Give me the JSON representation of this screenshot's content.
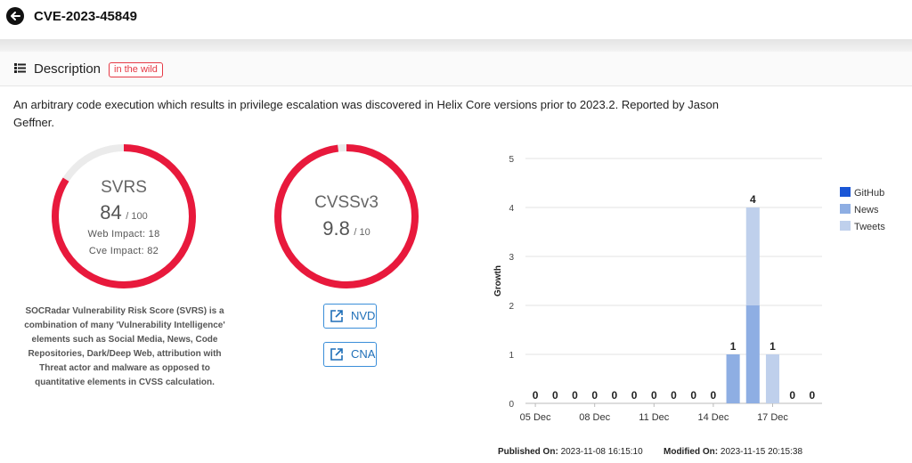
{
  "header": {
    "title": "CVE-2023-45849",
    "back_icon": "arrow-left-icon"
  },
  "description": {
    "heading": "Description",
    "badge": "in the wild",
    "text": "An arbitrary code execution which results in privilege escalation was discovered in Helix Core versions prior to 2023.2. Reported by Jason Geffner."
  },
  "svrs": {
    "title": "SVRS",
    "score": "84",
    "max": "/ 100",
    "score_value": 84,
    "web_impact": "Web Impact: 18",
    "cve_impact": "Cve Impact: 82",
    "note": "SOCRadar Vulnerability Risk Score (SVRS) is a combination of many 'Vulnerability Intelligence' elements such as Social Media, News, Code Repositories, Dark/Deep Web, attribution with Threat actor and malware as opposed to quantitative elements in CVSS calculation."
  },
  "cvss": {
    "title": "CVSSv3",
    "score": "9.8",
    "max": "/ 10",
    "score_value": 9.8
  },
  "links": {
    "nvd": "NVD",
    "cna": "CNA"
  },
  "colors": {
    "accent_red": "#e8193c",
    "ring_bg": "#ebebeb",
    "github": "#1a56d6",
    "news": "#8eaee3",
    "tweets": "#bfd0ec"
  },
  "chart_data": {
    "type": "bar",
    "stacked": true,
    "ylabel": "Growth",
    "ylim": [
      0,
      5
    ],
    "yticks": [
      0,
      1,
      2,
      3,
      4,
      5
    ],
    "categories": [
      "05 Dec",
      "06 Dec",
      "07 Dec",
      "08 Dec",
      "09 Dec",
      "10 Dec",
      "11 Dec",
      "12 Dec",
      "13 Dec",
      "14 Dec",
      "15 Dec",
      "16 Dec",
      "17 Dec",
      "18 Dec",
      "19 Dec"
    ],
    "xtick_labels": [
      {
        "index": 0,
        "label": "05 Dec"
      },
      {
        "index": 3,
        "label": "08 Dec"
      },
      {
        "index": 6,
        "label": "11 Dec"
      },
      {
        "index": 9,
        "label": "14 Dec"
      },
      {
        "index": 12,
        "label": "17 Dec"
      }
    ],
    "series": [
      {
        "name": "GitHub",
        "values": [
          0,
          0,
          0,
          0,
          0,
          0,
          0,
          0,
          0,
          0,
          0,
          0,
          0,
          0,
          0
        ]
      },
      {
        "name": "News",
        "values": [
          0,
          0,
          0,
          0,
          0,
          0,
          0,
          0,
          0,
          0,
          1,
          2,
          0,
          0,
          0
        ]
      },
      {
        "name": "Tweets",
        "values": [
          0,
          0,
          0,
          0,
          0,
          0,
          0,
          0,
          0,
          0,
          0,
          2,
          1,
          0,
          0
        ]
      }
    ],
    "totals": [
      0,
      0,
      0,
      0,
      0,
      0,
      0,
      0,
      0,
      0,
      1,
      4,
      1,
      0,
      0
    ],
    "legend_position": "right"
  },
  "footer": {
    "published_label": "Published On:",
    "published_value": "2023-11-08 16:15:10",
    "modified_label": "Modified On:",
    "modified_value": "2023-11-15 20:15:38"
  }
}
